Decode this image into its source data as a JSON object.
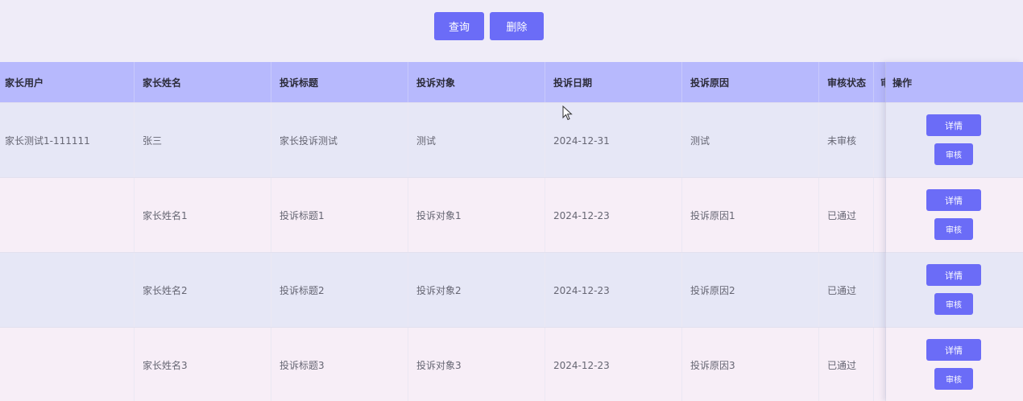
{
  "toolbar": {
    "query_label": "查询",
    "delete_label": "删除"
  },
  "table": {
    "headers": [
      "家长用户",
      "家长姓名",
      "投诉标题",
      "投诉对象",
      "投诉日期",
      "投诉原因",
      "审核状态",
      "审",
      "操作"
    ],
    "rows": [
      {
        "user": "家长测试1-111111",
        "name": "张三",
        "title": "家长投诉测试",
        "target": "测试",
        "date": "2024-12-31",
        "reason": "测试",
        "status": "未审核"
      },
      {
        "user": "",
        "name": "家长姓名1",
        "title": "投诉标题1",
        "target": "投诉对象1",
        "date": "2024-12-23",
        "reason": "投诉原因1",
        "status": "已通过"
      },
      {
        "user": "",
        "name": "家长姓名2",
        "title": "投诉标题2",
        "target": "投诉对象2",
        "date": "2024-12-23",
        "reason": "投诉原因2",
        "status": "已通过"
      },
      {
        "user": "",
        "name": "家长姓名3",
        "title": "投诉标题3",
        "target": "投诉对象3",
        "date": "2024-12-23",
        "reason": "投诉原因3",
        "status": "已通过"
      }
    ],
    "actions": {
      "detail_label": "详情",
      "review_label": "审核"
    }
  },
  "colors": {
    "accent": "#6b6cf7",
    "header_bg": "#b7b9fd",
    "page_bg": "#efecf8",
    "row_odd": "#e6e7f6",
    "row_even": "#f7eef7"
  },
  "icons": {
    "cursor": "mouse-pointer-icon"
  }
}
